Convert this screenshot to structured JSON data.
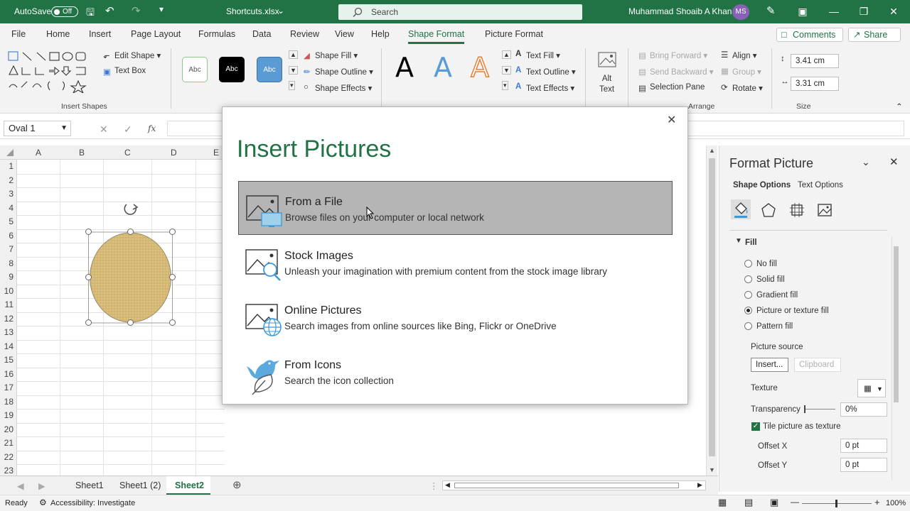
{
  "titlebar": {
    "autosave": "AutoSave",
    "toggle": "Off",
    "filename": "Shortcuts.xlsx",
    "search_placeholder": "Search",
    "user": "Muhammad Shoaib A Khan",
    "initials": "MS"
  },
  "menu": {
    "tabs": [
      "File",
      "Home",
      "Insert",
      "Page Layout",
      "Formulas",
      "Data",
      "Review",
      "View",
      "Help",
      "Shape Format",
      "Picture Format"
    ],
    "comments": "Comments",
    "share": "Share"
  },
  "ribbon": {
    "edit_shape": "Edit Shape",
    "text_box": "Text Box",
    "insert_shapes": "Insert Shapes",
    "style_label": "Abc",
    "shape_fill": "Shape Fill",
    "shape_outline": "Shape Outline",
    "shape_effects": "Shape Effects",
    "text_fill": "Text Fill",
    "text_outline": "Text Outline",
    "text_effects": "Text Effects",
    "alt_text": "Alt\nText",
    "bring_forward": "Bring Forward",
    "send_backward": "Send Backward",
    "selection_pane": "Selection Pane",
    "align": "Align",
    "group": "Group",
    "rotate": "Rotate",
    "arrange": "Arrange",
    "height": "3.41 cm",
    "width": "3.31 cm",
    "size": "Size",
    "wordart": "A"
  },
  "formula": {
    "name_box": "Oval 1",
    "fx": "fx"
  },
  "grid": {
    "columns": [
      "A",
      "B",
      "C",
      "D",
      "E"
    ],
    "rows": [
      "1",
      "2",
      "3",
      "4",
      "5",
      "6",
      "7",
      "8",
      "9",
      "10",
      "11",
      "12",
      "13",
      "14",
      "15",
      "16",
      "17",
      "18",
      "19",
      "20",
      "21",
      "22",
      "23"
    ]
  },
  "dialog": {
    "title": "Insert Pictures",
    "options": [
      {
        "title": "From a File",
        "desc": "Browse files on your computer or local network"
      },
      {
        "title": "Stock Images",
        "desc": "Unleash your imagination with premium content from the stock image library"
      },
      {
        "title": "Online Pictures",
        "desc": "Search images from online sources like Bing, Flickr or OneDrive"
      },
      {
        "title": "From Icons",
        "desc": "Search the icon collection"
      }
    ]
  },
  "pane": {
    "title": "Format Picture",
    "tab1": "Shape Options",
    "tab2": "Text Options",
    "fill": "Fill",
    "fill_options": [
      "No fill",
      "Solid fill",
      "Gradient fill",
      "Picture or texture fill",
      "Pattern fill"
    ],
    "selected_fill": 3,
    "picture_source": "Picture source",
    "insert_btn": "Insert...",
    "clipboard_btn": "Clipboard",
    "texture": "Texture",
    "transparency": "Transparency",
    "transparency_val": "0%",
    "tile": "Tile picture as texture",
    "offset_x": "Offset X",
    "offset_x_val": "0 pt",
    "offset_y": "Offset Y",
    "offset_y_val": "0 pt"
  },
  "sheets": {
    "tabs": [
      "Sheet1",
      "Sheet1 (2)",
      "Sheet2"
    ],
    "active": 2
  },
  "status": {
    "ready": "Ready",
    "accessibility": "Accessibility: Investigate",
    "zoom": "100%"
  },
  "colors": {
    "excel_green": "#217346",
    "shape_fill": "#d8bf7c"
  }
}
